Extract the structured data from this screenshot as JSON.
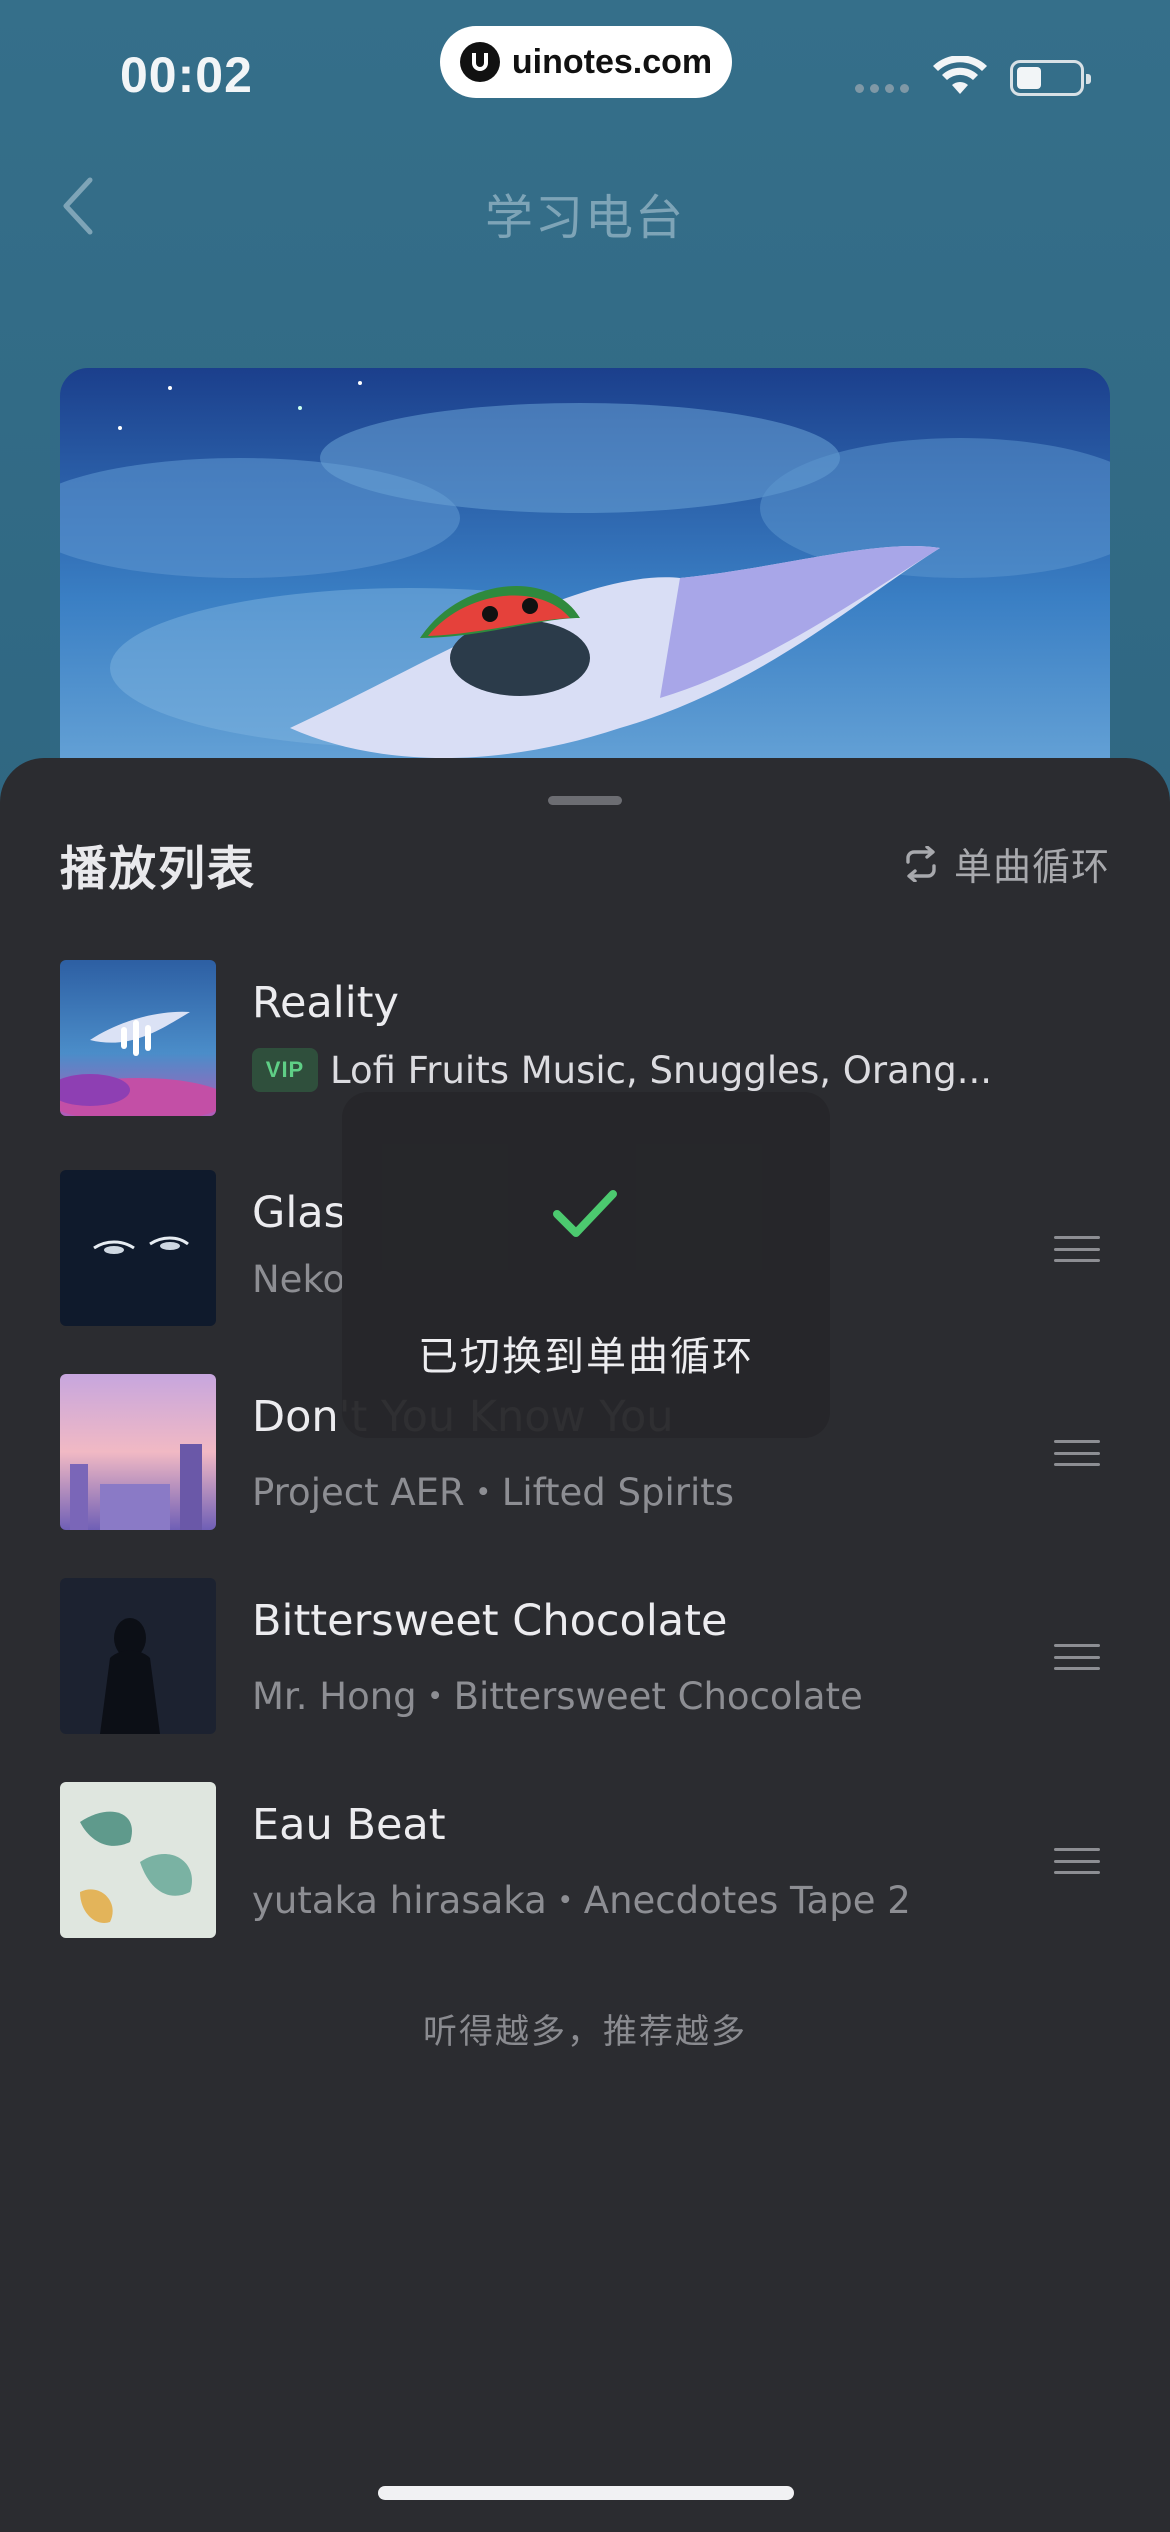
{
  "status_bar": {
    "time": "00:02",
    "watermark": "uinotes.com"
  },
  "nav": {
    "title": "学习电台"
  },
  "playlist": {
    "title": "播放列表",
    "mode_label": "单曲循环",
    "tracks": [
      {
        "title": "Reality",
        "badge": "VIP",
        "subtitle": "Lofi Fruits Music, Snuggles, Orang...",
        "playing": true
      },
      {
        "title": "Glas",
        "subtitle": "Neko",
        "playing": false
      },
      {
        "title": "Don't You Know You",
        "subtitle": "Project AER・Lifted Spirits",
        "playing": false
      },
      {
        "title": "Bittersweet Chocolate",
        "subtitle": "Mr. Hong・Bittersweet Chocolate",
        "playing": false
      },
      {
        "title": "Eau Beat",
        "subtitle": "yutaka hirasaka・Anecdotes Tape 2",
        "playing": false
      }
    ],
    "footer_hint": "听得越多，推荐越多"
  },
  "toast": {
    "message": "已切换到单曲循环"
  },
  "colors": {
    "accent_green": "#4cc96f",
    "sheet_bg": "#2b2c30",
    "page_bg": "#2f6a86"
  }
}
